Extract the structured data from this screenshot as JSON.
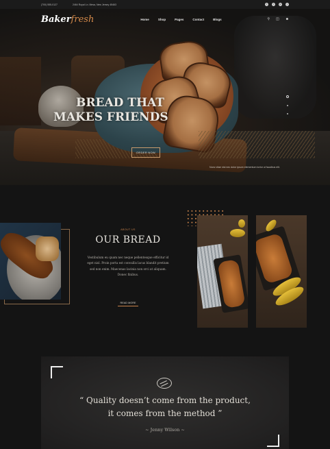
{
  "topbar": {
    "phone": "(700) 555-0127",
    "address": "2464 Royal Ln. Mesa, New Jersey 45463",
    "socials": [
      "f",
      "t",
      "p",
      "i"
    ]
  },
  "nav": {
    "logo_main": "Baker",
    "logo_accent": "fresh",
    "items": [
      "Home",
      "Shop",
      "Pages",
      "Contact",
      "Blogs"
    ],
    "icons": [
      "search-icon",
      "cart-icon",
      "user-icon"
    ]
  },
  "hero": {
    "title_line1": "BREAD THAT",
    "title_line2": "MAKES FRIENDS",
    "cta": "ORDER NOW",
    "caption": "Nunc vitae nisi nec dolor ipsum elementum tortor ut faucibus elit.",
    "slider_count": 3
  },
  "about": {
    "label": "ABOUT US",
    "title": "OUR BREAD",
    "paragraph": "Vestibulum eu quam nec neque pellentesque efficitur id eget nisl. Proin porta est convallis lacus blandit pretium sed non enim. Maecenas lacinia non orci at aliquam. Donec finibus.",
    "read_more": "READ MORE"
  },
  "testimonial": {
    "quote_line1": "“ Quality doesn’t come from the product,",
    "quote_line2": "it comes from the method ”",
    "author": "~ Jenny Wilson ~"
  },
  "colors": {
    "accent": "#c8824a",
    "background": "#141414"
  }
}
